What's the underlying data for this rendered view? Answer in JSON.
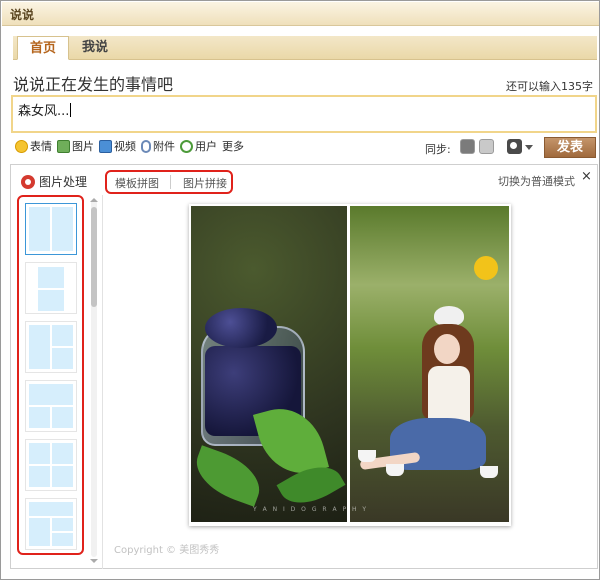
{
  "window": {
    "title": "说说"
  },
  "tabs": [
    {
      "label": "首页",
      "active": true
    },
    {
      "label": "我说",
      "active": false
    }
  ],
  "compose": {
    "heading": "说说正在发生的事情吧",
    "remaining": "还可以输入135字",
    "text": "森女风..."
  },
  "toolbar": {
    "items": [
      {
        "label": "表情",
        "icon": "emoji-icon"
      },
      {
        "label": "图片",
        "icon": "image-icon"
      },
      {
        "label": "视频",
        "icon": "video-icon"
      },
      {
        "label": "附件",
        "icon": "paperclip-icon"
      },
      {
        "label": "用户",
        "icon": "at-icon"
      },
      {
        "label": "更多",
        "icon": ""
      }
    ],
    "sync_label": "同步:",
    "publish_label": "发表"
  },
  "panel": {
    "title": "图片处理",
    "mode_tabs": [
      "模板拼图",
      "图片拼接"
    ],
    "switch_label": "切换为普通模式",
    "close_glyph": "×",
    "copyright": "Copyright © 美图秀秀",
    "photo_watermark": "Y A N I D O G R A P H Y"
  },
  "colors": {
    "accent_red": "#e0221b",
    "tab_bar": "#ead8a8",
    "publish_button": "#a06a3d",
    "template_cell": "#d6eefc"
  }
}
